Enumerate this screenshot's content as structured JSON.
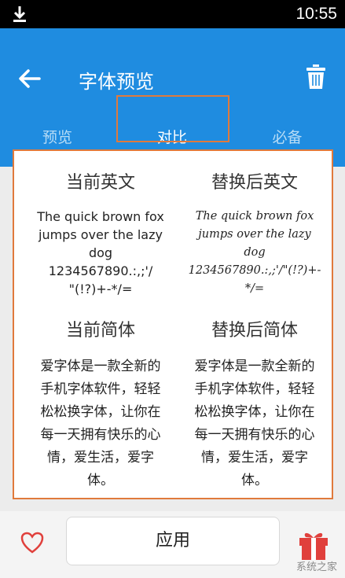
{
  "status_bar": {
    "time": "10:55"
  },
  "app_bar": {
    "title": "字体预览"
  },
  "tabs": [
    {
      "label": "预览"
    },
    {
      "label": "对比"
    },
    {
      "label": "必备"
    }
  ],
  "comparison": {
    "current_en": {
      "heading": "当前英文",
      "text_line1": "The quick brown fox",
      "text_line2": "jumps over the lazy",
      "text_line3": "dog",
      "text_line4": "1234567890.:,;'/",
      "text_line5": "\"(!?)+-*/="
    },
    "replaced_en": {
      "heading": "替换后英文",
      "text_line1": "The quick brown fox",
      "text_line2": "jumps over the lazy",
      "text_line3": "dog",
      "text_line4": "1234567890.:,;'/\"(!?)+-",
      "text_line5": "*/="
    },
    "current_cn": {
      "heading": "当前简体",
      "text_line1": "爱字体是一款全新的",
      "text_line2": "手机字体软件，轻轻",
      "text_line3": "松松换字体，让你在",
      "text_line4": "每一天拥有快乐的心",
      "text_line5": "情，爱生活，爱字",
      "text_line6": "体。"
    },
    "replaced_cn": {
      "heading": "替换后简体",
      "text_line1": "爱字体是一款全新的",
      "text_line2": "手机字体软件，轻轻",
      "text_line3": "松松换字体，让你在",
      "text_line4": "每一天拥有快乐的心",
      "text_line5": "情，爱生活，爱字",
      "text_line6": "体。"
    }
  },
  "bottom_bar": {
    "apply_label": "应用"
  },
  "watermark": "系统之家",
  "icons": {
    "download": "download-icon",
    "back": "back-arrow-icon",
    "trash": "trash-icon",
    "heart": "heart-icon",
    "gift": "gift-icon"
  },
  "colors": {
    "appbar": "#1f8ce0",
    "highlight": "#e07a3c",
    "heart": "#e0403c"
  }
}
